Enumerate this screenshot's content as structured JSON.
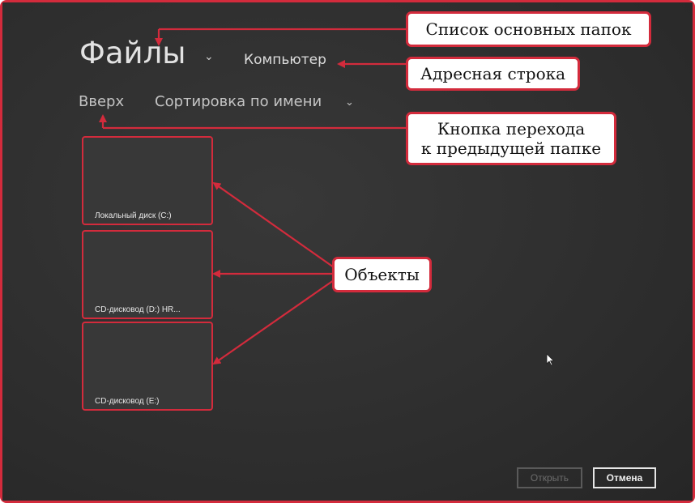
{
  "header": {
    "title": "Файлы",
    "title_chevron": "⌄",
    "address": "Компьютер"
  },
  "toolbar": {
    "up_label": "Вверх",
    "sort_label": "Сортировка по имени",
    "sort_chevron": "⌄"
  },
  "tiles": [
    {
      "label": "Локальный диск (C:)"
    },
    {
      "label": "CD-дисковод (D:) HR..."
    },
    {
      "label": "CD-дисковод (E:)"
    }
  ],
  "callouts": {
    "folders": "Список основных папок",
    "address": "Адресная строка",
    "back_line1": "Кнопка перехода",
    "back_line2": "к предыдущей папке",
    "objects": "Объекты"
  },
  "buttons": {
    "open": "Открыть",
    "cancel": "Отмена"
  },
  "colors": {
    "accent": "#d32b3c",
    "background": "#2f2f2f",
    "callout_bg": "#ffffff"
  }
}
